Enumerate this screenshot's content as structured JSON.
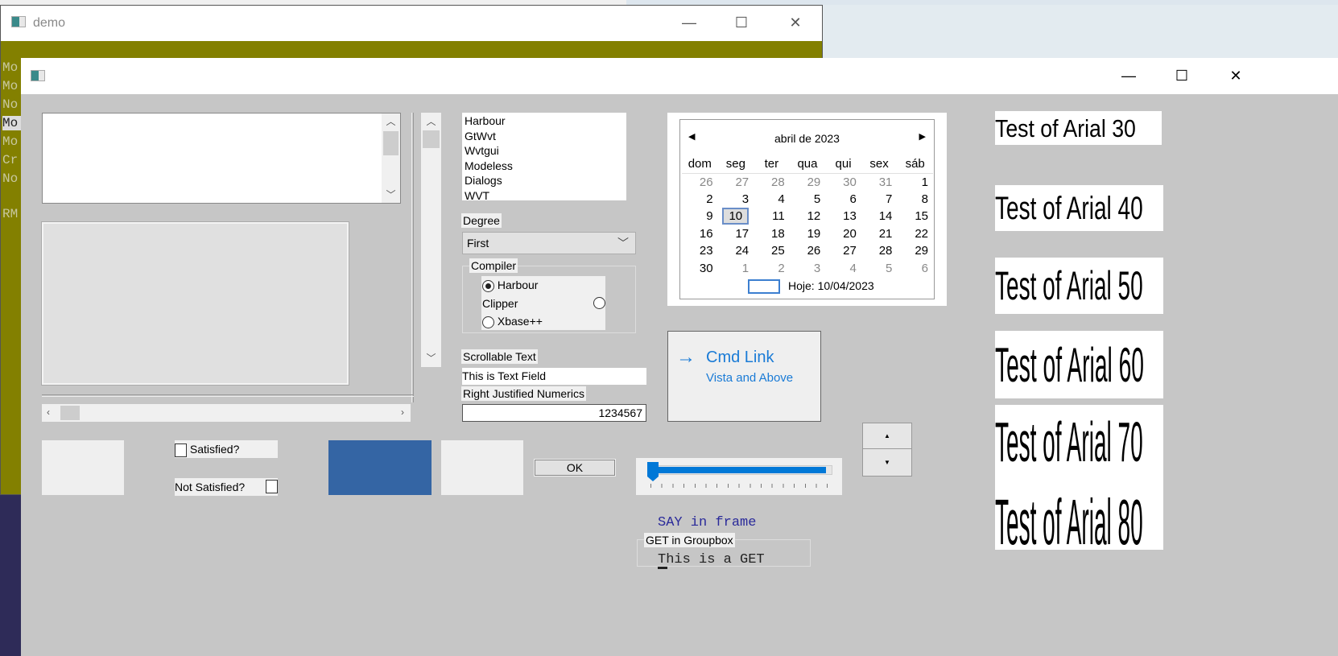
{
  "demo_window": {
    "title": "demo",
    "console_lines": [
      "Mo",
      "Mo",
      "No",
      "Mo",
      "Mo",
      "Cr",
      "No",
      "",
      "RM"
    ],
    "selected_line": 3
  },
  "inner_window": {
    "title": ""
  },
  "listbox": {
    "items": [
      "Harbour",
      "GtWvt",
      "Wvtgui",
      "Modeless",
      "Dialogs",
      "WVT"
    ]
  },
  "degree": {
    "label": "Degree",
    "value": "First"
  },
  "compiler": {
    "label": "Compiler",
    "options": [
      "Harbour",
      "Clipper",
      "Xbase++"
    ],
    "selected": "Harbour"
  },
  "fields": {
    "scroll_label": "Scrollable Text",
    "text_value": "This is Text Field",
    "numeric_label": "Right Justified Numerics",
    "numeric_value": "1234567"
  },
  "calendar": {
    "month": "abril de 2023",
    "days": [
      "dom",
      "seg",
      "ter",
      "qua",
      "qui",
      "sex",
      "sáb"
    ],
    "weeks": [
      [
        "26",
        "27",
        "28",
        "29",
        "30",
        "31",
        "1"
      ],
      [
        "2",
        "3",
        "4",
        "5",
        "6",
        "7",
        "8"
      ],
      [
        "9",
        "10",
        "11",
        "12",
        "13",
        "14",
        "15"
      ],
      [
        "16",
        "17",
        "18",
        "19",
        "20",
        "21",
        "22"
      ],
      [
        "23",
        "24",
        "25",
        "26",
        "27",
        "28",
        "29"
      ],
      [
        "30",
        "1",
        "2",
        "3",
        "4",
        "5",
        "6"
      ]
    ],
    "today": "Hoje: 10/04/2023",
    "selected": "10"
  },
  "cmdlink": {
    "title": "Cmd Link",
    "note": "Vista and Above"
  },
  "arial_labels": [
    "Test of Arial 30",
    "Test of Arial 40",
    "Test of Arial 50",
    "Test of Arial 60",
    "Test of Arial 70",
    "Test of Arial 80"
  ],
  "checks": {
    "satisfied": "Satisfied?",
    "not_satisfied": "Not Satisfied?"
  },
  "ok_button": "OK",
  "slider": {
    "value": 0
  },
  "say_text": "SAY in frame",
  "get_group": {
    "label": "GET in Groupbox",
    "value": "This is a GET"
  },
  "colors": {
    "olive": "#838000",
    "blue_box": "#3465a4",
    "accent": "#0078d7"
  }
}
